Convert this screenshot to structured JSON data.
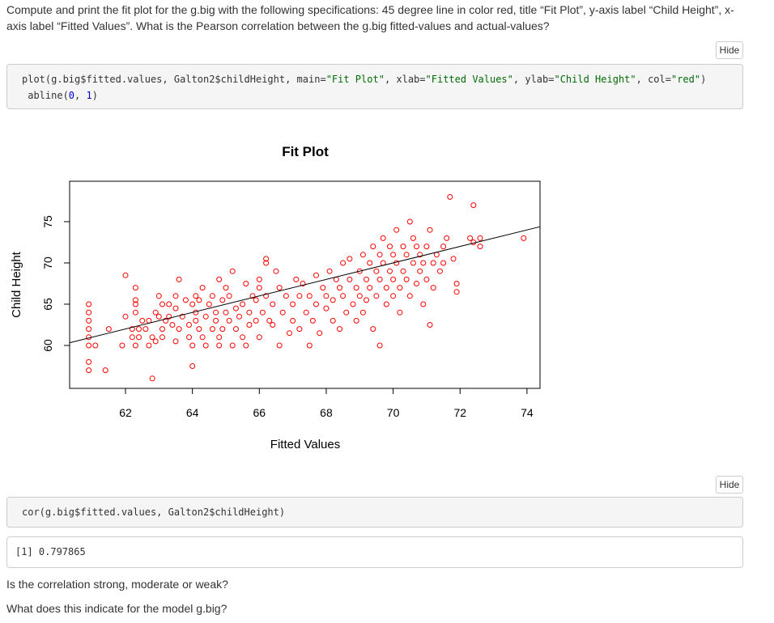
{
  "question": {
    "line1": "Compute and print the fit plot for the g.big with the following specifications: 45 degree line in color red, title “Fit Plot”, y-axis label “Child Height”, x-",
    "line2": "axis label “Fitted Values”. What is the Pearson correlation between the g.big fitted-values and actual-values?"
  },
  "chunk1": {
    "hide_label": "Hide",
    "code": {
      "l1_a": "plot(g.big$fitted.values, Galton2$childHeight, main=",
      "l1_s1": "\"Fit Plot\"",
      "l1_b": ", xlab=",
      "l1_s2": "\"Fitted Values\"",
      "l1_c": ", ylab=",
      "l1_s3": "\"Child Height\"",
      "l1_d": ", col=",
      "l1_s4": "\"red\"",
      "l1_e": ")",
      "l2_a": " abline(",
      "l2_n1": "0",
      "l2_b": ", ",
      "l2_n2": "1",
      "l2_c": ")"
    }
  },
  "chunk2": {
    "hide_label": "Hide",
    "code": "cor(g.big$fitted.values, Galton2$childHeight)",
    "output": "[1] 0.797865"
  },
  "followups": {
    "q1": "Is the correlation strong, moderate or weak?",
    "q2": "What does this indicate for the model g.big?"
  },
  "chart_data": {
    "type": "scatter",
    "title": "Fit Plot",
    "xlabel": "Fitted Values",
    "ylabel": "Child Height",
    "xlim": [
      60.33,
      74.39
    ],
    "ylim": [
      54.8,
      79.9
    ],
    "x_ticks": [
      62,
      64,
      66,
      68,
      70,
      72,
      74
    ],
    "y_ticks": [
      60,
      65,
      70,
      75
    ],
    "point_color": "#ff0000",
    "line_color": "#000000",
    "grid": false,
    "legend": "none",
    "abline": {
      "intercept": 0,
      "slope": 1
    },
    "points_note": "approximate representative sample read from the plot",
    "points": [
      [
        60.9,
        65
      ],
      [
        60.9,
        64
      ],
      [
        60.9,
        63
      ],
      [
        60.9,
        62
      ],
      [
        60.9,
        61
      ],
      [
        60.9,
        60
      ],
      [
        60.9,
        58
      ],
      [
        60.9,
        57
      ],
      [
        61.1,
        60
      ],
      [
        61.4,
        57
      ],
      [
        61.5,
        62
      ],
      [
        61.9,
        60
      ],
      [
        62.0,
        68.5
      ],
      [
        62.0,
        63.5
      ],
      [
        62.2,
        62
      ],
      [
        62.2,
        61
      ],
      [
        62.3,
        65
      ],
      [
        62.3,
        64
      ],
      [
        62.3,
        67
      ],
      [
        62.3,
        65.5
      ],
      [
        62.3,
        60
      ],
      [
        62.4,
        62
      ],
      [
        62.4,
        61
      ],
      [
        62.5,
        63
      ],
      [
        62.6,
        62
      ],
      [
        62.7,
        60
      ],
      [
        62.7,
        63
      ],
      [
        62.8,
        56
      ],
      [
        62.8,
        61
      ],
      [
        62.9,
        60.5
      ],
      [
        62.9,
        64
      ],
      [
        63.0,
        66
      ],
      [
        63.0,
        63.5
      ],
      [
        63.1,
        65
      ],
      [
        63.1,
        62
      ],
      [
        63.1,
        61
      ],
      [
        63.2,
        63
      ],
      [
        63.3,
        65
      ],
      [
        63.3,
        63.5
      ],
      [
        63.4,
        62.5
      ],
      [
        63.5,
        60.5
      ],
      [
        63.5,
        64.5
      ],
      [
        63.5,
        66
      ],
      [
        63.6,
        68
      ],
      [
        63.6,
        62
      ],
      [
        63.7,
        63.5
      ],
      [
        63.8,
        65.5
      ],
      [
        63.9,
        61
      ],
      [
        63.9,
        62.5
      ],
      [
        64.0,
        65
      ],
      [
        64.0,
        60
      ],
      [
        64.0,
        57.5
      ],
      [
        64.1,
        66
      ],
      [
        64.1,
        64
      ],
      [
        64.1,
        63
      ],
      [
        64.2,
        62
      ],
      [
        64.2,
        65.5
      ],
      [
        64.3,
        61
      ],
      [
        64.3,
        67
      ],
      [
        64.4,
        63.5
      ],
      [
        64.4,
        60
      ],
      [
        64.5,
        65
      ],
      [
        64.6,
        62
      ],
      [
        64.6,
        66
      ],
      [
        64.7,
        64
      ],
      [
        64.7,
        63
      ],
      [
        64.8,
        60
      ],
      [
        64.8,
        61
      ],
      [
        64.8,
        68
      ],
      [
        64.9,
        65.5
      ],
      [
        64.9,
        62
      ],
      [
        65.0,
        67
      ],
      [
        65.0,
        64
      ],
      [
        65.1,
        63
      ],
      [
        65.1,
        66
      ],
      [
        65.2,
        69
      ],
      [
        65.2,
        60
      ],
      [
        65.3,
        62
      ],
      [
        65.3,
        64.5
      ],
      [
        65.4,
        63.5
      ],
      [
        65.5,
        65
      ],
      [
        65.5,
        61
      ],
      [
        65.6,
        60
      ],
      [
        65.6,
        67.5
      ],
      [
        65.7,
        64
      ],
      [
        65.7,
        62.5
      ],
      [
        65.8,
        66
      ],
      [
        65.9,
        65.5
      ],
      [
        65.9,
        63
      ],
      [
        66.0,
        68
      ],
      [
        66.0,
        67
      ],
      [
        66.0,
        61
      ],
      [
        66.1,
        64
      ],
      [
        66.2,
        70.5
      ],
      [
        66.2,
        70
      ],
      [
        66.2,
        66
      ],
      [
        66.3,
        63
      ],
      [
        66.4,
        65
      ],
      [
        66.4,
        62.5
      ],
      [
        66.5,
        69
      ],
      [
        66.6,
        67
      ],
      [
        66.6,
        60
      ],
      [
        66.7,
        64
      ],
      [
        66.8,
        66
      ],
      [
        66.9,
        61.5
      ],
      [
        67.0,
        65
      ],
      [
        67.0,
        63
      ],
      [
        67.1,
        68
      ],
      [
        67.2,
        66
      ],
      [
        67.2,
        62
      ],
      [
        67.3,
        67.5
      ],
      [
        67.4,
        64
      ],
      [
        67.5,
        66
      ],
      [
        67.5,
        60
      ],
      [
        67.6,
        63
      ],
      [
        67.7,
        65
      ],
      [
        67.7,
        68.5
      ],
      [
        67.8,
        61.5
      ],
      [
        67.9,
        67
      ],
      [
        68.0,
        64.5
      ],
      [
        68.0,
        66
      ],
      [
        68.1,
        69
      ],
      [
        68.2,
        63
      ],
      [
        68.2,
        65.5
      ],
      [
        68.3,
        68
      ],
      [
        68.4,
        67
      ],
      [
        68.4,
        62
      ],
      [
        68.5,
        70
      ],
      [
        68.5,
        66
      ],
      [
        68.6,
        64
      ],
      [
        68.7,
        70.5
      ],
      [
        68.7,
        68
      ],
      [
        68.8,
        65
      ],
      [
        68.9,
        67
      ],
      [
        68.9,
        63
      ],
      [
        69.0,
        69
      ],
      [
        69.0,
        66
      ],
      [
        69.1,
        71
      ],
      [
        69.1,
        64
      ],
      [
        69.2,
        68
      ],
      [
        69.2,
        65.5
      ],
      [
        69.3,
        70
      ],
      [
        69.3,
        67
      ],
      [
        69.4,
        72
      ],
      [
        69.4,
        62
      ],
      [
        69.5,
        69
      ],
      [
        69.5,
        66
      ],
      [
        69.6,
        71
      ],
      [
        69.6,
        68
      ],
      [
        69.6,
        60
      ],
      [
        69.7,
        73
      ],
      [
        69.7,
        70
      ],
      [
        69.8,
        67
      ],
      [
        69.8,
        65
      ],
      [
        69.9,
        72
      ],
      [
        69.9,
        69
      ],
      [
        70.0,
        71
      ],
      [
        70.0,
        68
      ],
      [
        70.0,
        66
      ],
      [
        70.1,
        70
      ],
      [
        70.1,
        74
      ],
      [
        70.2,
        67
      ],
      [
        70.2,
        64
      ],
      [
        70.3,
        72
      ],
      [
        70.3,
        69
      ],
      [
        70.4,
        71
      ],
      [
        70.4,
        68
      ],
      [
        70.5,
        75
      ],
      [
        70.5,
        66
      ],
      [
        70.6,
        70
      ],
      [
        70.6,
        73
      ],
      [
        70.7,
        72
      ],
      [
        70.7,
        67.5
      ],
      [
        70.8,
        69
      ],
      [
        70.8,
        71
      ],
      [
        70.9,
        70
      ],
      [
        70.9,
        65
      ],
      [
        71.0,
        72
      ],
      [
        71.0,
        68
      ],
      [
        71.1,
        74
      ],
      [
        71.1,
        62.5
      ],
      [
        71.2,
        70
      ],
      [
        71.2,
        67
      ],
      [
        71.3,
        71
      ],
      [
        71.4,
        69
      ],
      [
        71.5,
        72
      ],
      [
        71.5,
        70
      ],
      [
        71.6,
        73
      ],
      [
        71.7,
        78
      ],
      [
        71.8,
        70.5
      ],
      [
        71.9,
        67.5
      ],
      [
        71.9,
        66.5
      ],
      [
        72.3,
        73
      ],
      [
        72.4,
        72.5
      ],
      [
        72.4,
        77
      ],
      [
        72.6,
        73
      ],
      [
        72.6,
        72
      ],
      [
        73.9,
        73
      ]
    ]
  }
}
